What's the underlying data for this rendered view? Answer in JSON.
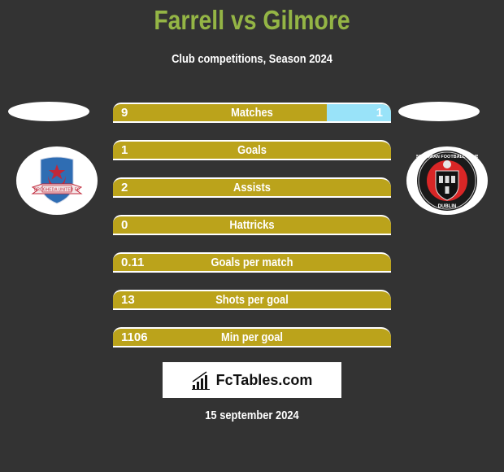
{
  "header": {
    "title": "Farrell vs Gilmore",
    "subtitle": "Club competitions, Season 2024"
  },
  "teams": {
    "left": {
      "name": "Drogheda United FC",
      "logo_icon": "drogheda-united-crest-icon"
    },
    "right": {
      "name": "Bohemian Football Club Dublin",
      "logo_icon": "bohemian-fc-crest-icon"
    }
  },
  "colors": {
    "left_bar": "#bba31b",
    "right_bar": "#99e3f9",
    "title": "#94b545",
    "background": "#333333"
  },
  "stats": [
    {
      "label": "Matches",
      "left": "9",
      "right": "1",
      "right_share": 0.23
    },
    {
      "label": "Goals",
      "left": "1",
      "right": "",
      "right_share": 0
    },
    {
      "label": "Assists",
      "left": "2",
      "right": "",
      "right_share": 0
    },
    {
      "label": "Hattricks",
      "left": "0",
      "right": "",
      "right_share": 0
    },
    {
      "label": "Goals per match",
      "left": "0.11",
      "right": "",
      "right_share": 0
    },
    {
      "label": "Shots per goal",
      "left": "13",
      "right": "",
      "right_share": 0
    },
    {
      "label": "Min per goal",
      "left": "1106",
      "right": "",
      "right_share": 0
    }
  ],
  "brand": {
    "label": "FcTables.com",
    "icon": "bar-chart-icon"
  },
  "footer": {
    "date": "15 september 2024"
  }
}
